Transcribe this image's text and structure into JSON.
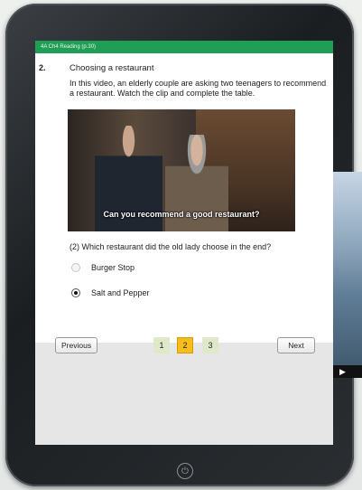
{
  "header": {
    "title": "4A Ch4 Reading (p.30)"
  },
  "question": {
    "number": "2.",
    "title": "Choosing a restaurant",
    "instructions": "In this video, an elderly couple are asking two teenagers to recommend a restaurant. Watch the clip and complete the table.",
    "video_caption": "Can you recommend a good restaurant?",
    "prompt": "(2) Which restaurant did the old lady choose in the end?",
    "options": [
      {
        "label": "Burger Stop",
        "selected": false
      },
      {
        "label": "Salt and Pepper",
        "selected": true
      }
    ]
  },
  "navigation": {
    "previous_label": "Previous",
    "next_label": "Next",
    "pages": [
      "1",
      "2",
      "3"
    ],
    "current_page": "2"
  },
  "device": {
    "home_icon": "power-icon",
    "home_glyph": "⏻"
  },
  "side_video": {
    "play_glyph": "▶"
  },
  "colors": {
    "header": "#1f9e56",
    "current_page": "#f6be1a",
    "page": "#dfe8c8"
  }
}
